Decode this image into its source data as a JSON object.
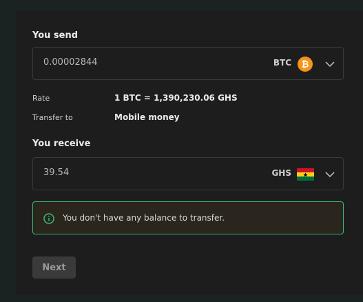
{
  "send": {
    "label": "You send",
    "amount": "0.00002844",
    "currency": "BTC",
    "currency_icon": "bitcoin-icon"
  },
  "details": {
    "rate_label": "Rate",
    "rate_value": "1 BTC = 1,390,230.06 GHS",
    "transfer_label": "Transfer to",
    "transfer_value": "Mobile money"
  },
  "receive": {
    "label": "You receive",
    "amount": "39.54",
    "currency": "GHS",
    "currency_icon": "ghana-flag-icon"
  },
  "alert": {
    "icon": "info-circle-icon",
    "message": "You don't have any balance to transfer."
  },
  "actions": {
    "next_label": "Next"
  },
  "colors": {
    "background": "#1a2322",
    "panel": "#1d1d1d",
    "alert_border": "#3cb77c",
    "bitcoin_orange": "#f7931a"
  }
}
